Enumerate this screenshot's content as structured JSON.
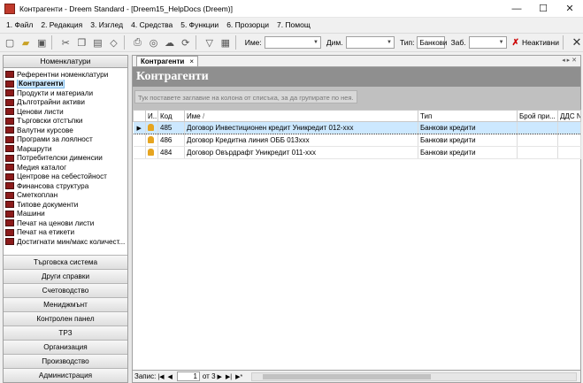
{
  "window": {
    "title": "Контрагенти - Dreem Standard - [Dreem15_HelpDocs (Dreem)]"
  },
  "menu": [
    "1. Файл",
    "2. Редакция",
    "3. Изглед",
    "4. Средства",
    "5. Функции",
    "6. Прозорци",
    "7. Помощ"
  ],
  "toolbar": {
    "name_label": "Име:",
    "name_value": "",
    "dim_label": "Дим.",
    "dim_value": "",
    "type_label": "Тип:",
    "type_value": "Банкови",
    "zab_label": "Заб.",
    "zab_value": "",
    "inactive_label": "Неактивни"
  },
  "sidebar": {
    "header": "Номенклатури",
    "items": [
      "Референтни номенклатури",
      "Контрагенти",
      "Продукти и материали",
      "Дълготрайни активи",
      "Ценови листи",
      "Търговски отстъпки",
      "Валутни курсове",
      "Програми за лоялност",
      "Маршрути",
      "Потребителски дименсии",
      "Медия каталог",
      "Центрове на себестойност",
      "Финансова структура",
      "Сметкоплан",
      "Типове документи",
      "Машини",
      "Печат на ценови листи",
      "Печат на етикети",
      "Достигнати мин/макс количест..."
    ],
    "selected_index": 1,
    "groups": [
      "Търговска система",
      "Други справки",
      "Счетоводство",
      "Мениджмънт",
      "Контролен панел",
      "ТРЗ",
      "Организация",
      "Производство",
      "Администрация"
    ]
  },
  "main": {
    "tab_label": "Контрагенти",
    "tab_close": "×",
    "banner": "Контрагенти",
    "group_hint": "Тук поставете заглавие на колона от списъка, за да групирате по нея.",
    "columns": [
      "И...",
      "Код",
      "Име",
      "Тип",
      "Брой при...",
      "ДДС No"
    ],
    "rows": [
      {
        "code": "485",
        "name": "Договор Инвестиционен кредит Уникредит 012-xxx",
        "type": "Банкови кредити",
        "count": "",
        "vat": ""
      },
      {
        "code": "486",
        "name": "Договор Кредитна линия ОББ 013xxx",
        "type": "Банкови кредити",
        "count": "",
        "vat": ""
      },
      {
        "code": "484",
        "name": "Договор Овърдрафт Уникредит 011-xxx",
        "type": "Банкови кредити",
        "count": "",
        "vat": ""
      }
    ],
    "pager": {
      "label": "Запис:",
      "current": "1",
      "of_text": "от 3"
    }
  }
}
